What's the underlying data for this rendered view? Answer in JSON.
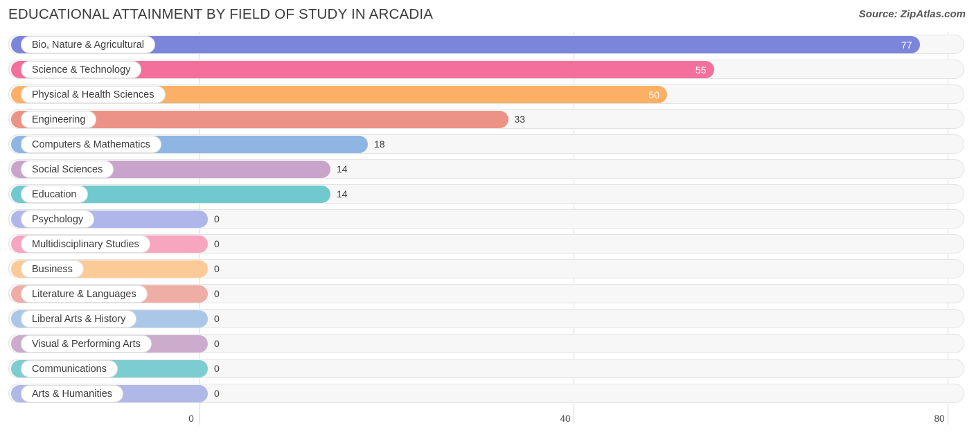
{
  "header": {
    "title": "EDUCATIONAL ATTAINMENT BY FIELD OF STUDY IN ARCADIA",
    "source": "Source: ZipAtlas.com"
  },
  "chart_data": {
    "type": "bar",
    "orientation": "horizontal",
    "title": "EDUCATIONAL ATTAINMENT BY FIELD OF STUDY IN ARCADIA",
    "xlabel": "",
    "ylabel": "",
    "xlim": [
      0,
      80
    ],
    "ticks": [
      "0",
      "40",
      "80"
    ],
    "tick_values": [
      0,
      40,
      80
    ],
    "grid": true,
    "legend": "none",
    "categories": [
      "Bio, Nature & Agricultural",
      "Science & Technology",
      "Physical & Health Sciences",
      "Engineering",
      "Computers & Mathematics",
      "Social Sciences",
      "Education",
      "Psychology",
      "Multidisciplinary Studies",
      "Business",
      "Literature & Languages",
      "Liberal Arts & History",
      "Visual & Performing Arts",
      "Communications",
      "Arts & Humanities"
    ],
    "values": [
      77,
      55,
      50,
      33,
      18,
      14,
      14,
      0,
      0,
      0,
      0,
      0,
      0,
      0,
      0
    ],
    "value_labels": [
      "77",
      "55",
      "50",
      "33",
      "18",
      "14",
      "14",
      "0",
      "0",
      "0",
      "0",
      "0",
      "0",
      "0",
      "0"
    ],
    "colors": [
      "#7b85da",
      "#f4709c",
      "#fbb065",
      "#ed9287",
      "#8fb6e3",
      "#c8a4ca",
      "#6fc9cf",
      "#aeb6ea",
      "#f8a5c0",
      "#fbca97",
      "#eeada5",
      "#aac7e8",
      "#cbaccd",
      "#7ccdd1",
      "#b0b8e8"
    ]
  }
}
